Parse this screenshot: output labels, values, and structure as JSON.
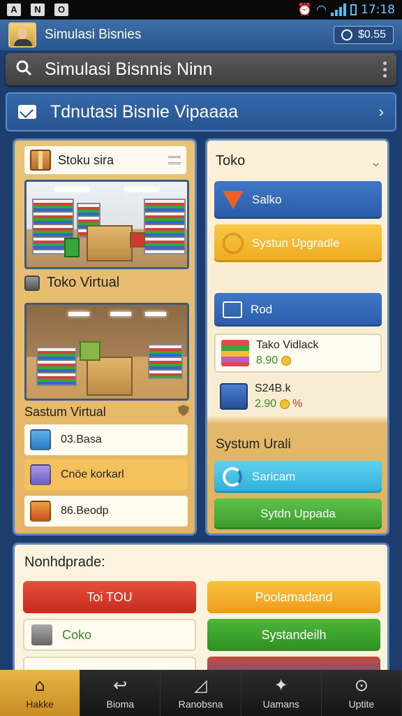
{
  "status_bar": {
    "time": "17:18",
    "left_icons": [
      "A",
      "N",
      "O"
    ]
  },
  "app_bar": {
    "title": "Simulasi Bisnies",
    "chip_label": "$0.55"
  },
  "search": {
    "text": "Simulasi Bisnnis Ninn"
  },
  "section_header": {
    "title": "Tdnutasi Bisnie Vipaaaa"
  },
  "left_panel": {
    "head_label": "Stoku sira",
    "store_title": "Toko Virtual",
    "system_title": "Sastum Virtual",
    "items": [
      {
        "label": "03.Basa",
        "icon": "blue-cube-icon"
      },
      {
        "label": "Cnöe korkarl",
        "icon": "purple-cube-icon"
      },
      {
        "label": "86.Beodp",
        "icon": "red-cube-icon"
      }
    ]
  },
  "right_panel": {
    "title": "Toko",
    "buttons": [
      {
        "label": "Salko"
      },
      {
        "label": "Systun Upgradle"
      },
      {
        "label": "Rod"
      }
    ],
    "items": [
      {
        "name": "Tako Vidlack",
        "price": "8.90"
      },
      {
        "name": "S24B.k",
        "price": "2.90",
        "extra": "%"
      }
    ],
    "system_title": "Systum Urali",
    "bottom_buttons": [
      {
        "label": "Saricam"
      },
      {
        "label": "Sytdn Uppada"
      }
    ]
  },
  "bottom_panel": {
    "title": "Nonhdprade:",
    "buttons": [
      {
        "label": "Toi TOU"
      },
      {
        "label": "Poolamadand"
      },
      {
        "label": "Coko"
      },
      {
        "label": "Systandeilh"
      }
    ]
  },
  "nav": [
    {
      "label": "Hakke",
      "icon": "home-icon"
    },
    {
      "label": "Bioma",
      "icon": "back-arrow-icon"
    },
    {
      "label": "Ranobsna",
      "icon": "chart-icon"
    },
    {
      "label": "Uamans",
      "icon": "person-icon"
    },
    {
      "label": "Uptite",
      "icon": "search-icon"
    }
  ],
  "colors": {
    "accent_blue": "#2a568e",
    "panel_gold": "#e5b564",
    "btn_red": "#d63a2a",
    "btn_green": "#3aa53a",
    "btn_yellow": "#f3b82a",
    "btn_teal": "#36b6d8"
  }
}
